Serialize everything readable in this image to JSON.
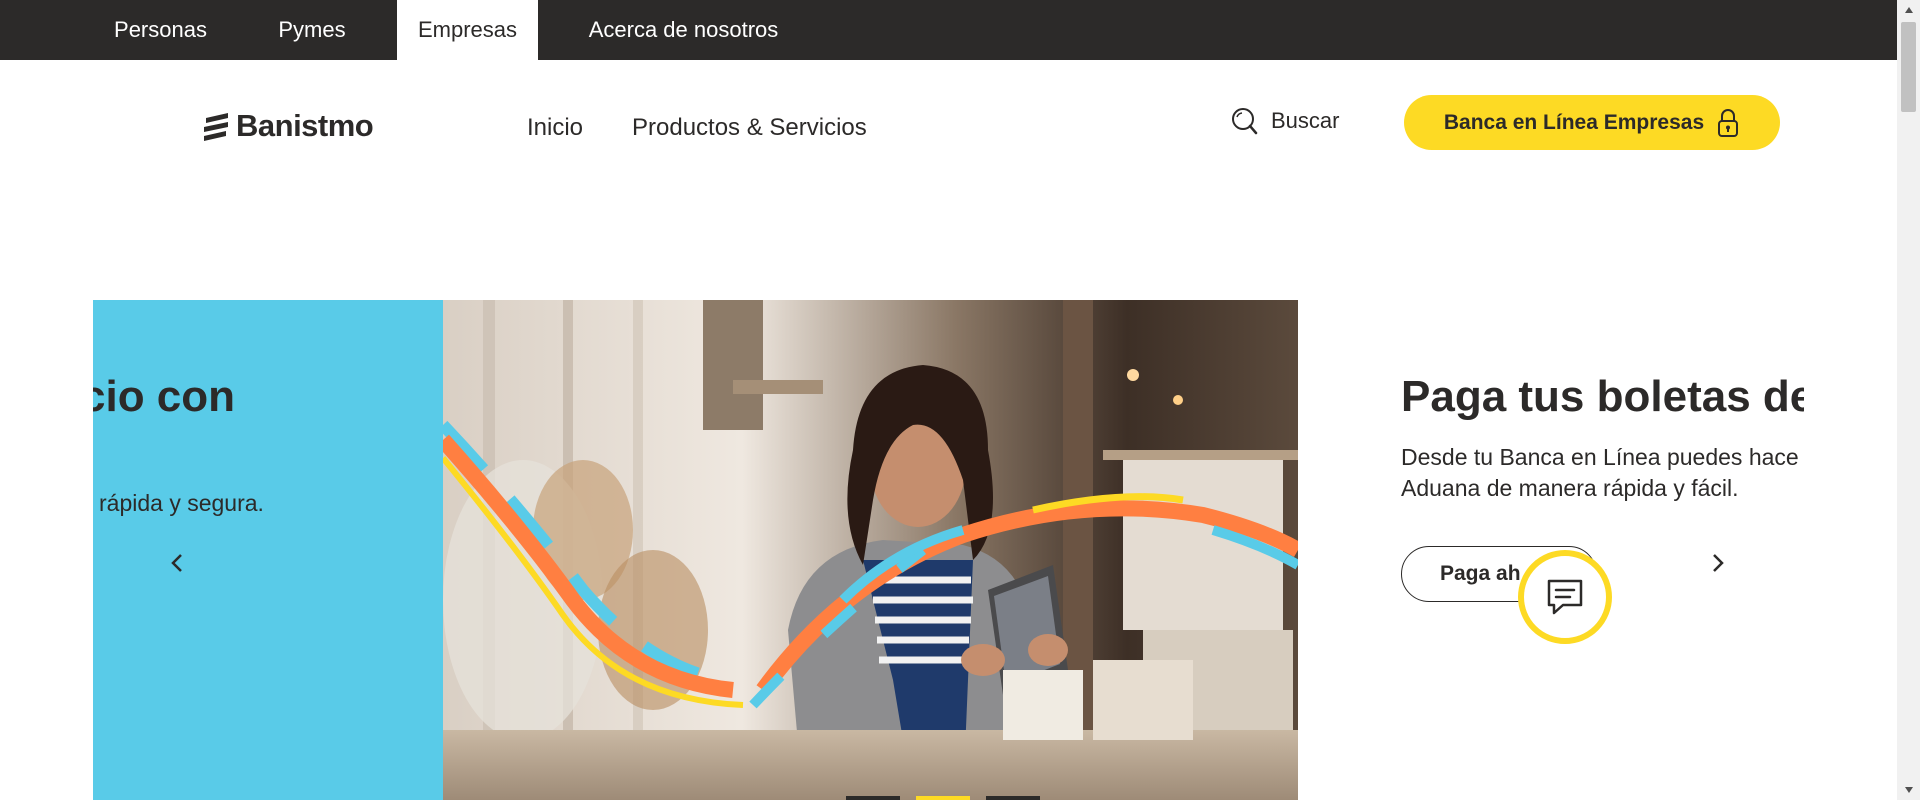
{
  "topbar": {
    "segments": [
      {
        "label": "Personas",
        "active": false
      },
      {
        "label": "Pymes",
        "active": false
      },
      {
        "label": "Empresas",
        "active": true
      },
      {
        "label": "Acerca de nosotros",
        "active": false
      }
    ]
  },
  "header": {
    "logo_text": "Banistmo",
    "nav": [
      {
        "label": "Inicio"
      },
      {
        "label": "Productos & Servicios"
      }
    ],
    "search_label": "Buscar",
    "cta_label": "Banca en Línea Empresas"
  },
  "carousel": {
    "prev_slide": {
      "title": "cio con",
      "desc": "rápida y segura."
    },
    "next_slide": {
      "title": "Paga tus boletas de",
      "desc_line1": "Desde tu Banca en Línea puedes hace",
      "desc_line2": "Aduana de manera rápida y fácil.",
      "button_label": "Paga ah"
    },
    "indicator_count": 3,
    "active_indicator": 1
  },
  "colors": {
    "brand_yellow": "#fdda24",
    "brand_dark": "#2c2a29",
    "slide_blue": "#59cbe8",
    "ribbon_orange": "#ff7f41"
  },
  "icons": {
    "search": "search-icon",
    "lock": "lock-icon",
    "chat": "chat-icon",
    "prev": "chevron-left-icon",
    "next": "chevron-right-icon"
  }
}
